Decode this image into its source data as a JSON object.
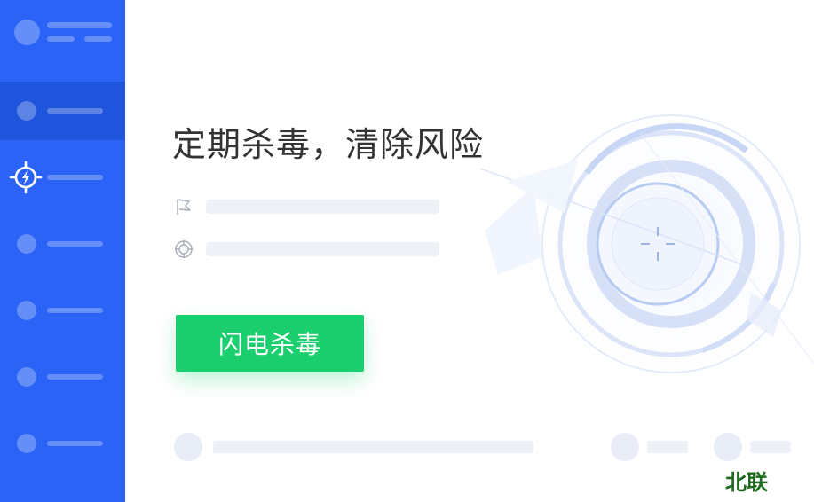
{
  "headline": "定期杀毒，清除风险",
  "scan_button": {
    "label": "闪电杀毒"
  },
  "watermark": "北联",
  "colors": {
    "sidebar": "#2a63f5",
    "sidebar_active": "#1f55dc",
    "button": "#1ccf6e",
    "headline": "#333333"
  },
  "sidebar": {
    "items": [
      {
        "icon": "placeholder-dot",
        "active": true
      },
      {
        "icon": "lightning-shield-icon",
        "active": false
      },
      {
        "icon": "placeholder-dot",
        "active": false
      },
      {
        "icon": "placeholder-dot",
        "active": false
      },
      {
        "icon": "placeholder-dot",
        "active": false
      },
      {
        "icon": "placeholder-dot",
        "active": false
      }
    ]
  },
  "info_rows": [
    {
      "icon": "flag-icon"
    },
    {
      "icon": "target-icon"
    }
  ]
}
